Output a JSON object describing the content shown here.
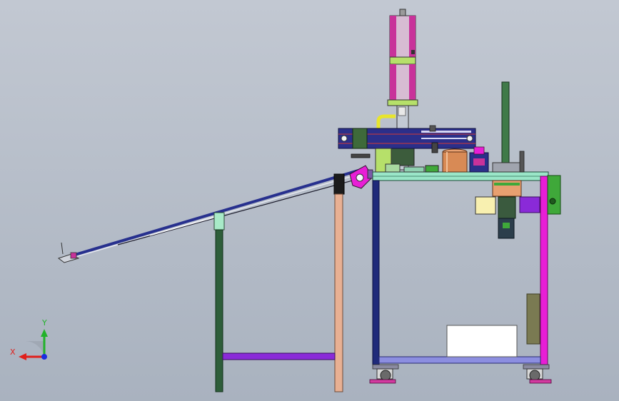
{
  "viewport": {
    "background_top": "#c2c8d2",
    "background_bottom": "#a9b2bf"
  },
  "triad": {
    "x_label": "X",
    "y_label": "Y",
    "x_color": "#e0201c",
    "y_color": "#22b22a",
    "z_color": "#1c2ee0"
  },
  "colors": {
    "cylinder_magenta": "#c8329a",
    "cylinder_body": "#d7bcd3",
    "cylinder_lime": "#b6e06a",
    "frame_magenta": "#e81ed6",
    "frame_navy": "#1f2a7a",
    "table_top": "#9ae6c8",
    "leg_green": "#2e5e3a",
    "leg_peach": "#e8b093",
    "crossbar_purple": "#8a2ad8",
    "chute_blue": "#27308e",
    "copper": "#d88a55",
    "motor_green": "#3fa83a",
    "mast_green": "#3f7a48"
  }
}
